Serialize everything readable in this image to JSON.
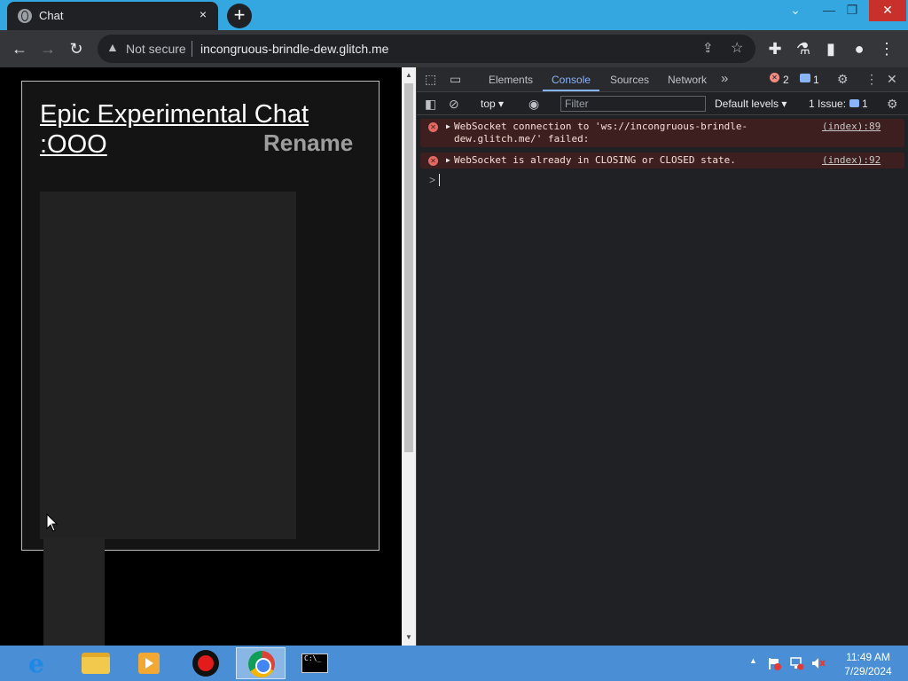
{
  "browser": {
    "tab_title": "Chat",
    "tab_close": "×",
    "new_tab": "+",
    "omnibox": {
      "security_label": "Not secure",
      "url": "incongruous-brindle-dew.glitch.me"
    }
  },
  "page": {
    "chat_title": "Epic Experimental Chat :OOO",
    "rename_label": "Rename"
  },
  "devtools": {
    "tabs": [
      "Elements",
      "Console",
      "Sources",
      "Network"
    ],
    "more_tabs": "»",
    "error_count": "2",
    "info_count": "1",
    "context": "top",
    "filter_placeholder": "Filter",
    "levels": "Default levels",
    "issues_label": "1 Issue:",
    "issues_count": "1",
    "messages": [
      {
        "text": "WebSocket connection to 'ws://incongruous-brindle-dew.glitch.me/' failed:",
        "source": "(index):89"
      },
      {
        "text": "WebSocket is already in CLOSING or CLOSED state.",
        "source": "(index):92"
      }
    ],
    "prompt": ">"
  },
  "taskbar": {
    "time": "11:49 AM",
    "date": "7/29/2024",
    "items": [
      "internet-explorer",
      "file-explorer",
      "media-player",
      "recorder",
      "chrome",
      "command-prompt"
    ]
  }
}
